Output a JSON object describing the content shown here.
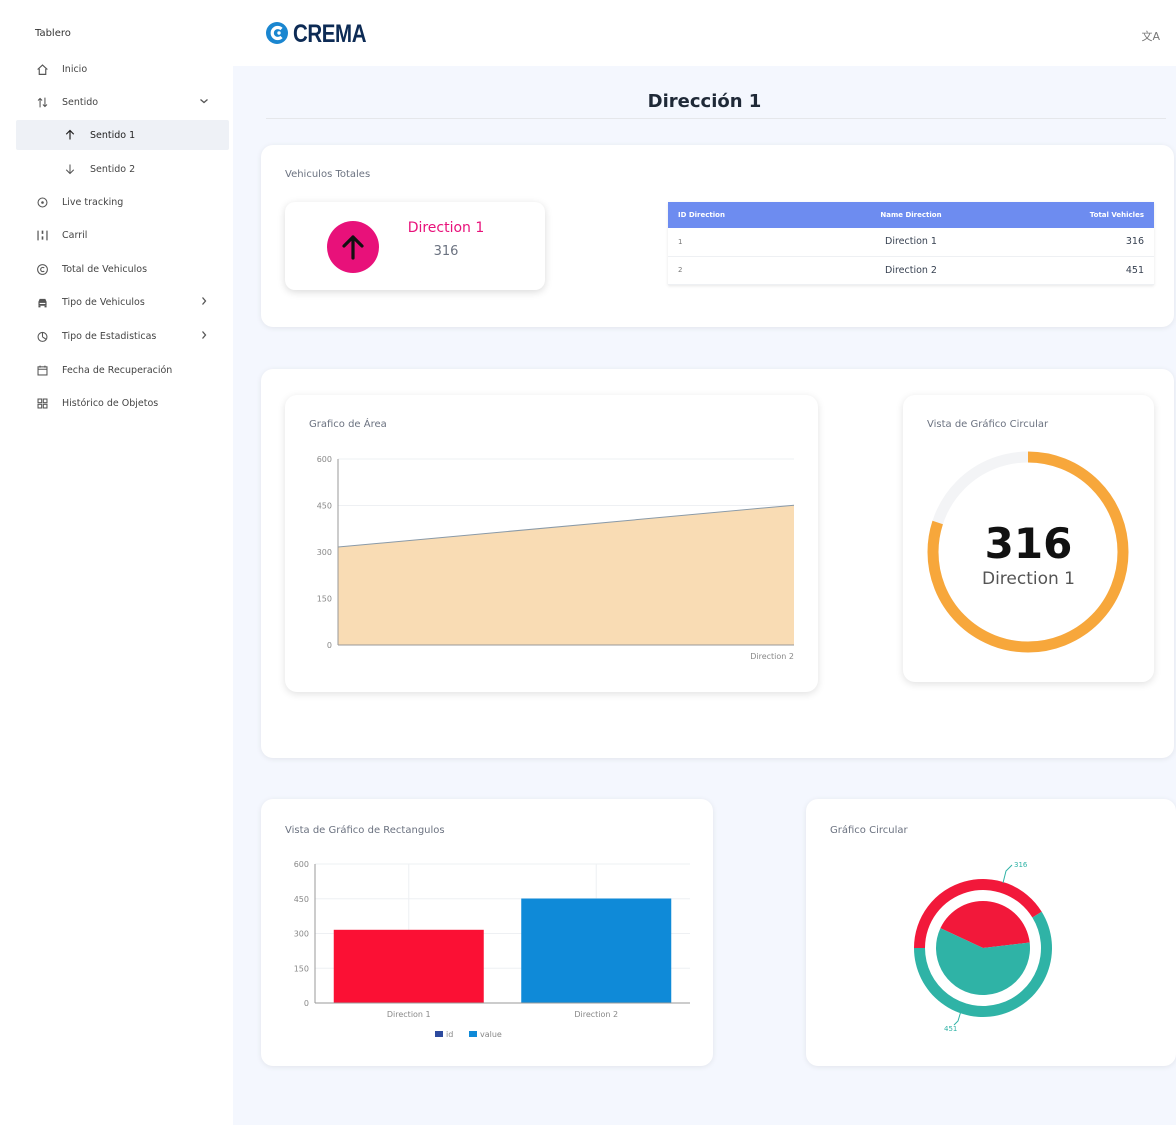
{
  "sidebar": {
    "title": "Tablero",
    "items": [
      {
        "label": "Inicio",
        "icon": "home-icon"
      },
      {
        "label": "Sentido",
        "icon": "sort-arrows-icon"
      },
      {
        "label": "Sentido 1",
        "icon": "arrow-up-icon"
      },
      {
        "label": "Sentido 2",
        "icon": "arrow-down-icon"
      },
      {
        "label": "Live tracking",
        "icon": "tracking-icon"
      },
      {
        "label": "Carril",
        "icon": "lane-icon"
      },
      {
        "label": "Total de Vehiculos",
        "icon": "copyright-icon"
      },
      {
        "label": "Tipo de Vehiculos",
        "icon": "car-icon"
      },
      {
        "label": "Tipo de Estadisticas",
        "icon": "pie-icon"
      },
      {
        "label": "Fecha de Recuperación",
        "icon": "calendar-icon"
      },
      {
        "label": "Histórico de Objetos",
        "icon": "grid-icon"
      }
    ]
  },
  "header": {
    "brand": "CREMA",
    "logo_icon": "crema-logo-icon",
    "lang_icon": "translate-icon",
    "lang_label": "文A"
  },
  "page_title": "Dirección 1",
  "totals_card": {
    "label": "Vehiculos Totales",
    "stat": {
      "name": "Direction 1",
      "value": "316",
      "color": "#e8117a"
    },
    "table": {
      "headers": [
        "ID Direction",
        "Name Direction",
        "Total Vehicles"
      ],
      "rows": [
        [
          "1",
          "Direction 1",
          "316"
        ],
        [
          "2",
          "Direction 2",
          "451"
        ]
      ]
    }
  },
  "area_card": {
    "label": "Grafico de Área"
  },
  "radial_card": {
    "label": "Vista de Gráfico Circular",
    "value": "316",
    "name": "Direction 1",
    "color": "#f7a73b",
    "fraction": 0.8
  },
  "bar_card": {
    "label": "Vista de Gráfico de Rectangulos"
  },
  "pie_card": {
    "label": "Gráfico Circular"
  },
  "chart_data": [
    {
      "type": "area",
      "title": "Grafico de Área",
      "x": [
        "Direction 1",
        "Direction 2"
      ],
      "x_tick_labels_shown": [
        "Direction 2"
      ],
      "values": [
        316,
        451
      ],
      "y_ticks": [
        0,
        150,
        300,
        450,
        600
      ],
      "ylim": [
        0,
        600
      ],
      "color": "#f9dcb4",
      "grid": true
    },
    {
      "type": "bar",
      "title": "Vista de Gráfico de Rectangulos",
      "categories": [
        "Direction 1",
        "Direction 2"
      ],
      "values": [
        316,
        451
      ],
      "bar_colors": [
        "#fb1034",
        "#0f8ad8"
      ],
      "y_ticks": [
        0,
        150,
        300,
        450,
        600
      ],
      "ylim": [
        0,
        600
      ],
      "legend": [
        "id",
        "value"
      ],
      "legend_colors": [
        "#2d4a9e",
        "#0f8ad8"
      ],
      "legend_position": "bottom"
    },
    {
      "type": "pie",
      "title": "Gráfico Circular",
      "labels": [
        "Direction 1",
        "Direction 2"
      ],
      "values": [
        316,
        451
      ],
      "colors": [
        "#f2183a",
        "#2fb3a6"
      ],
      "outer_labels": [
        "316",
        "451"
      ]
    }
  ]
}
